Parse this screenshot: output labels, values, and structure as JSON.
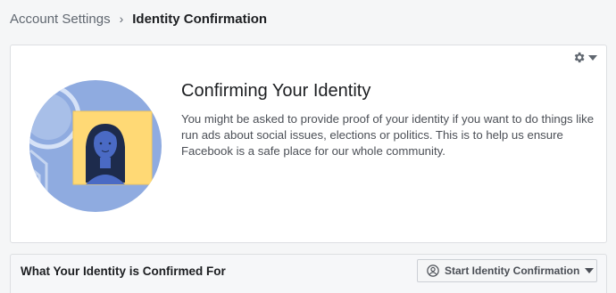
{
  "breadcrumb": {
    "parent": "Account Settings",
    "separator": "›",
    "current": "Identity Confirmation"
  },
  "card": {
    "title": "Confirming Your Identity",
    "description": "You might be asked to provide proof of your identity if you want to do things like run ads about social issues, elections or politics. This is to help us ensure Facebook is a safe place for our whole community.",
    "menu_icon": "gear-icon"
  },
  "section": {
    "title": "What Your Identity is Confirmed For",
    "button_label": "Start Identity Confirmation",
    "button_icon": "user-circle-icon"
  },
  "colors": {
    "accent_blue": "#4267b2",
    "illustration_blue": "#8fabe0",
    "illustration_yellow": "#ffd975",
    "text_primary": "#1c1e21",
    "text_secondary": "#606770",
    "card_border": "#dddfe2"
  }
}
